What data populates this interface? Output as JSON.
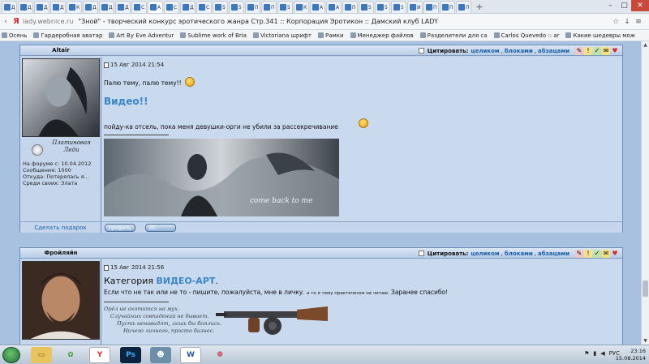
{
  "browser": {
    "tabs": [
      {
        "label": "Д"
      },
      {
        "label": "Д"
      },
      {
        "label": "Д"
      },
      {
        "label": "Д"
      },
      {
        "label": "К"
      },
      {
        "label": "Д"
      },
      {
        "label": "Д"
      },
      {
        "label": "Д"
      },
      {
        "label": "С"
      },
      {
        "label": "А"
      },
      {
        "label": "С"
      },
      {
        "label": "Д"
      },
      {
        "label": "С"
      },
      {
        "label": "5"
      },
      {
        "label": "5"
      },
      {
        "label": "П"
      },
      {
        "label": "П"
      },
      {
        "label": "5"
      },
      {
        "label": "К"
      },
      {
        "label": "А"
      },
      {
        "label": "А"
      },
      {
        "label": "П"
      },
      {
        "label": "5"
      },
      {
        "label": "5"
      },
      {
        "label": "5"
      },
      {
        "label": "И"
      },
      {
        "label": "П"
      },
      {
        "label": "П"
      },
      {
        "label": "П"
      }
    ],
    "url": "lady.webnice.ru",
    "page_title": "\"Зной\" - творческий конкурс эротического жанра Стр.341 :: Корпорация Эротикон :: Дамский клуб LADY",
    "bookmarks": [
      "Осень",
      "Гардеробная аватар",
      "Art By Eve Adventur",
      "Sublime work of Bria",
      "Victoriana шрифт",
      "Рамки",
      "Менеджер файлов",
      "Разделители для са",
      "Carlos Quevedo :: ar",
      "Какие шедевры мож"
    ]
  },
  "cite_labels": {
    "cite": "Цитировать:",
    "whole": "целиком",
    "blocks": "блоками",
    "paragraphs": "абзацами"
  },
  "posts": [
    {
      "author": "Altair",
      "date": "15 Авг 2014 21:54",
      "line1": "Палю тему, палю тему!!",
      "headline": "Видео!!",
      "line2": "пойду-ка отсель, пока меня девушки-орги не убили за рассекречивание",
      "image_caption": "come back to me",
      "rank": "Платиновая Леди",
      "meta": [
        "На форуме с: 10.04.2012",
        "Сообщения: 1000",
        "Откуда: Потерялась я...",
        "Среди своих: Злата"
      ],
      "gift": "Сделать подарок",
      "profile_btn": "профиль",
      "pm_btn": "ЛС"
    },
    {
      "author": "Фройляйн",
      "date": "15 Авг 2014 21:56",
      "headline_prefix": "Категория",
      "headline_accent": "ВИДЕО-АРТ",
      "line1": "Если что не так или не то - пишите, пожалуйста, мне в личку.",
      "line1_small": "а то я тему практически не читаю.",
      "line1_end": "Заранее спасибо!",
      "signature": [
        "Орёл не охотится на мух.",
        "Случайных совпадений не бывает.",
        "Пусть ненавидят, лишь бы боялись.",
        "Ничего личного, просто бизнес."
      ]
    }
  ],
  "taskbar": {
    "lang": "РУС",
    "time": "23:16",
    "date": "15.08.2014"
  }
}
